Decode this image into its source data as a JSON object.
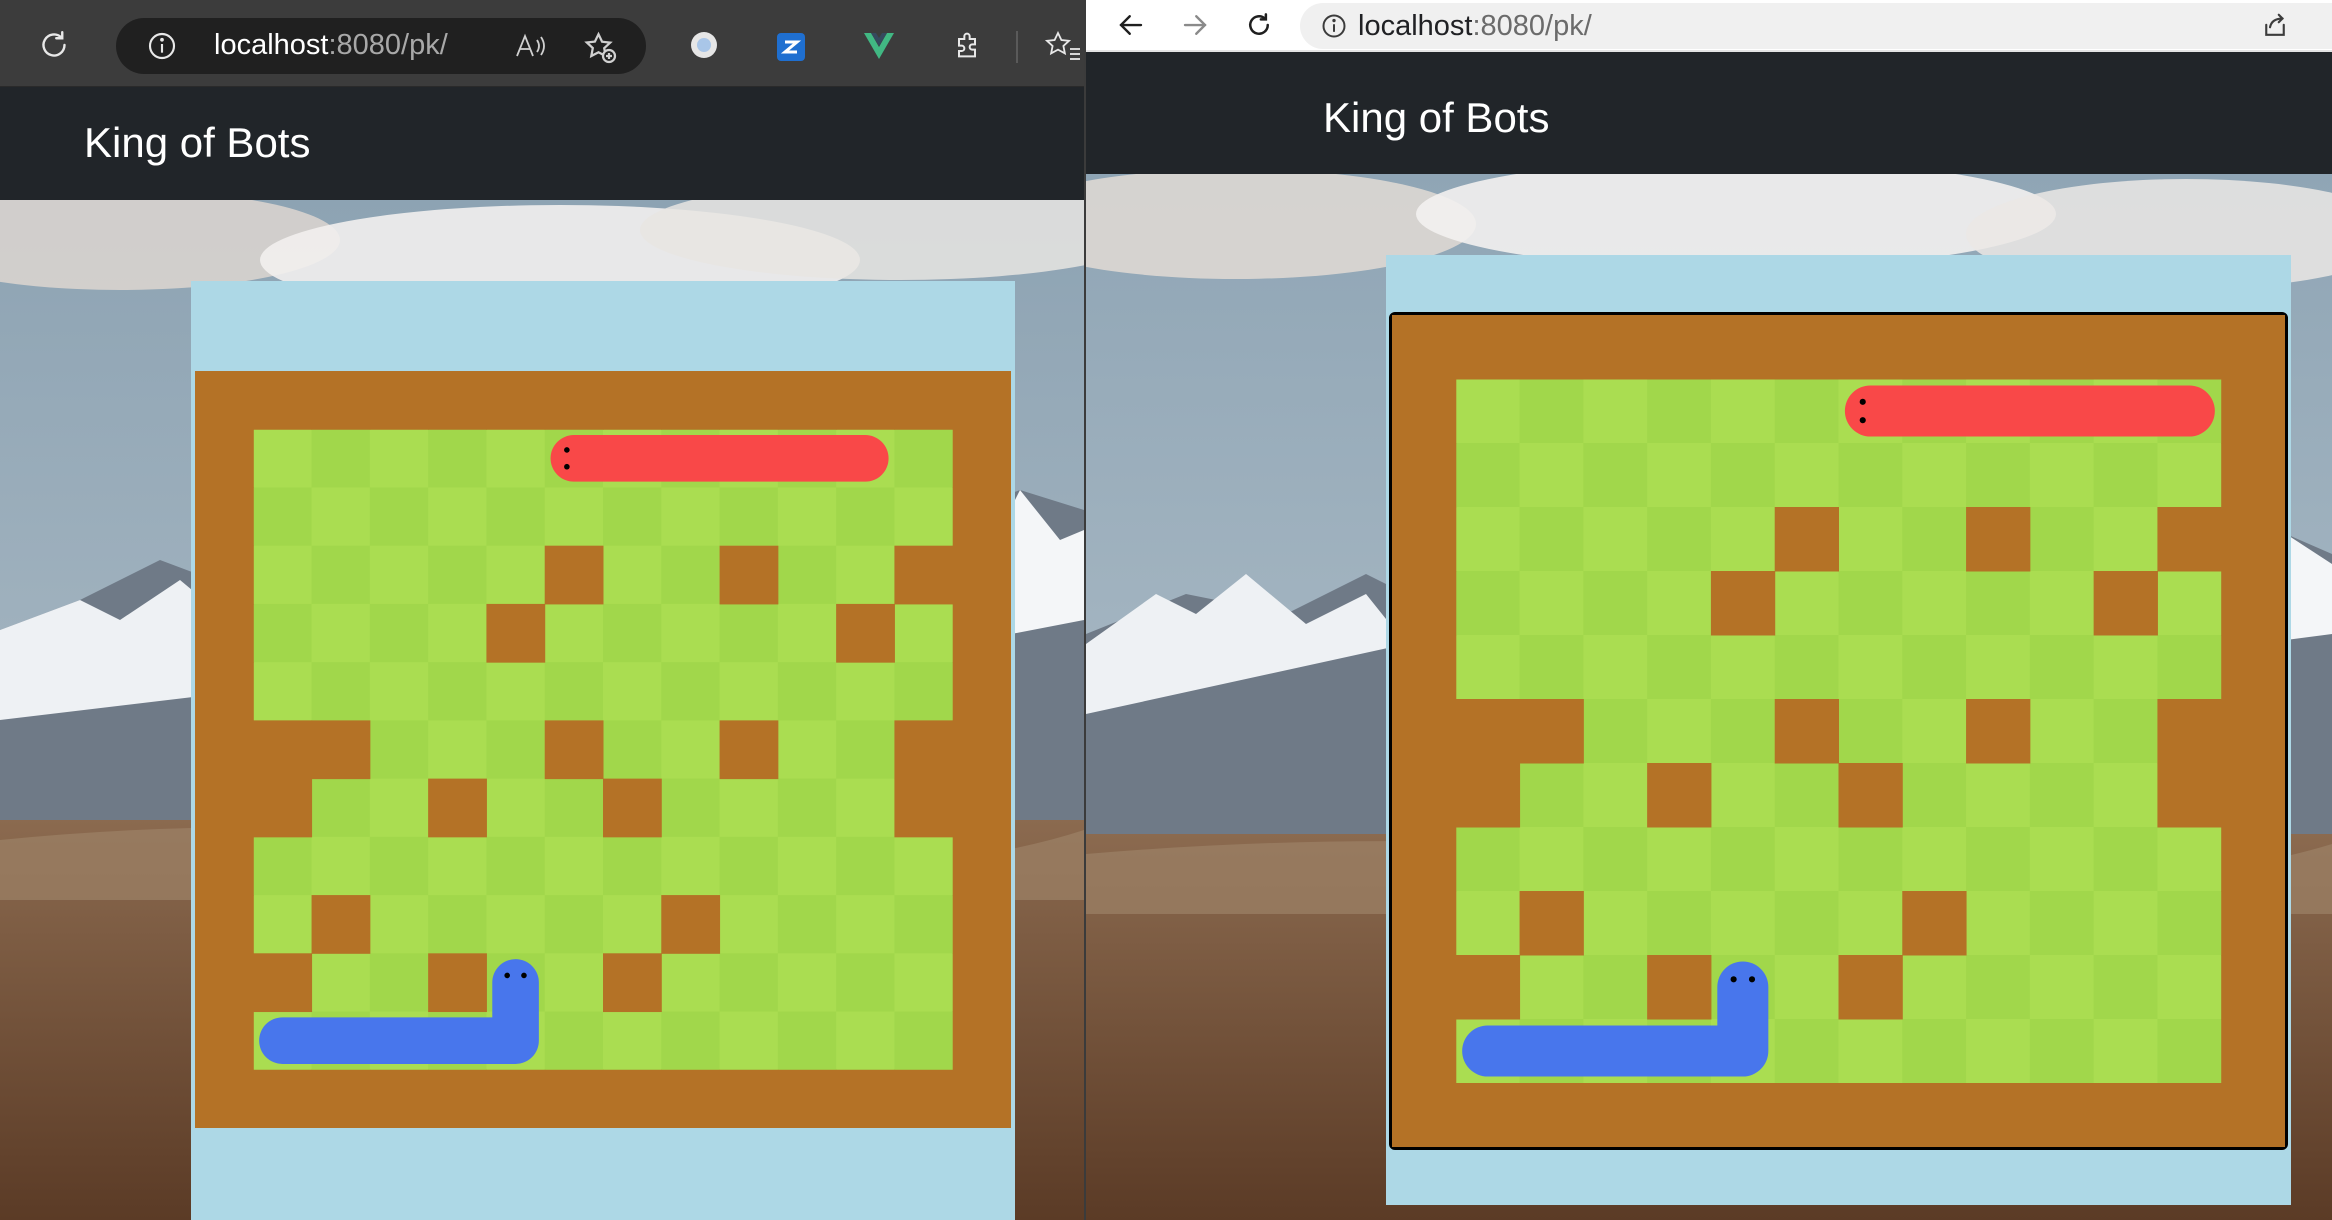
{
  "browser": {
    "url_host": "localhost",
    "url_rest": ":8080/pk/"
  },
  "navbar": {
    "brand": "King of Bots"
  },
  "colors": {
    "navbar": "#212529",
    "game_area": "#add8e6",
    "wall": "#b47226",
    "grass_light": "#aadd51",
    "grass_dark": "#a1d74b",
    "snake_red": "#f94848",
    "snake_blue": "#4876ec"
  },
  "icons": {
    "left_toolbar": [
      "refresh-icon",
      "info-icon",
      "read-aloud-icon",
      "add-favorite-icon",
      "extension-circle-icon",
      "zotero-extension-icon",
      "vue-devtools-icon",
      "extensions-icon",
      "favorites-icon"
    ],
    "right_toolbar": [
      "back-icon",
      "forward-icon",
      "refresh-icon",
      "info-icon",
      "share-icon"
    ]
  },
  "game": {
    "left": {
      "rows": 13,
      "cols": 14,
      "walls": [
        [
          0,
          0
        ],
        [
          0,
          1
        ],
        [
          0,
          2
        ],
        [
          0,
          3
        ],
        [
          0,
          4
        ],
        [
          0,
          5
        ],
        [
          0,
          6
        ],
        [
          0,
          7
        ],
        [
          0,
          8
        ],
        [
          0,
          9
        ],
        [
          0,
          10
        ],
        [
          0,
          11
        ],
        [
          0,
          12
        ],
        [
          0,
          13
        ],
        [
          12,
          0
        ],
        [
          12,
          1
        ],
        [
          12,
          2
        ],
        [
          12,
          3
        ],
        [
          12,
          4
        ],
        [
          12,
          5
        ],
        [
          12,
          6
        ],
        [
          12,
          7
        ],
        [
          12,
          8
        ],
        [
          12,
          9
        ],
        [
          12,
          10
        ],
        [
          12,
          11
        ],
        [
          12,
          12
        ],
        [
          12,
          13
        ],
        [
          1,
          0
        ],
        [
          2,
          0
        ],
        [
          3,
          0
        ],
        [
          4,
          0
        ],
        [
          5,
          0
        ],
        [
          6,
          0
        ],
        [
          7,
          0
        ],
        [
          8,
          0
        ],
        [
          9,
          0
        ],
        [
          10,
          0
        ],
        [
          11,
          0
        ],
        [
          1,
          13
        ],
        [
          2,
          13
        ],
        [
          3,
          13
        ],
        [
          4,
          13
        ],
        [
          5,
          13
        ],
        [
          6,
          13
        ],
        [
          7,
          13
        ],
        [
          8,
          13
        ],
        [
          9,
          13
        ],
        [
          10,
          13
        ],
        [
          11,
          13
        ],
        [
          3,
          12
        ],
        [
          6,
          1
        ],
        [
          6,
          2
        ],
        [
          7,
          1
        ],
        [
          7,
          12
        ],
        [
          10,
          1
        ],
        [
          6,
          12
        ],
        [
          3,
          6
        ],
        [
          3,
          9
        ],
        [
          4,
          5
        ],
        [
          4,
          11
        ],
        [
          6,
          6
        ],
        [
          6,
          9
        ],
        [
          7,
          4
        ],
        [
          7,
          7
        ],
        [
          9,
          2
        ],
        [
          9,
          8
        ],
        [
          10,
          4
        ],
        [
          10,
          7
        ]
      ],
      "snake_red": [
        [
          1,
          6
        ],
        [
          1,
          7
        ],
        [
          1,
          8
        ],
        [
          1,
          9
        ],
        [
          1,
          10
        ],
        [
          1,
          11
        ]
      ],
      "snake_blue": [
        [
          10,
          5
        ],
        [
          11,
          5
        ],
        [
          11,
          4
        ],
        [
          11,
          3
        ],
        [
          11,
          2
        ],
        [
          11,
          1
        ]
      ]
    },
    "right": {
      "rows": 13,
      "cols": 14,
      "walls": [
        [
          0,
          0
        ],
        [
          0,
          1
        ],
        [
          0,
          2
        ],
        [
          0,
          3
        ],
        [
          0,
          4
        ],
        [
          0,
          5
        ],
        [
          0,
          6
        ],
        [
          0,
          7
        ],
        [
          0,
          8
        ],
        [
          0,
          9
        ],
        [
          0,
          10
        ],
        [
          0,
          11
        ],
        [
          0,
          12
        ],
        [
          0,
          13
        ],
        [
          12,
          0
        ],
        [
          12,
          1
        ],
        [
          12,
          2
        ],
        [
          12,
          3
        ],
        [
          12,
          4
        ],
        [
          12,
          5
        ],
        [
          12,
          6
        ],
        [
          12,
          7
        ],
        [
          12,
          8
        ],
        [
          12,
          9
        ],
        [
          12,
          10
        ],
        [
          12,
          11
        ],
        [
          12,
          12
        ],
        [
          12,
          13
        ],
        [
          1,
          0
        ],
        [
          2,
          0
        ],
        [
          3,
          0
        ],
        [
          4,
          0
        ],
        [
          5,
          0
        ],
        [
          6,
          0
        ],
        [
          7,
          0
        ],
        [
          8,
          0
        ],
        [
          9,
          0
        ],
        [
          10,
          0
        ],
        [
          11,
          0
        ],
        [
          1,
          13
        ],
        [
          2,
          13
        ],
        [
          3,
          13
        ],
        [
          4,
          13
        ],
        [
          5,
          13
        ],
        [
          6,
          13
        ],
        [
          7,
          13
        ],
        [
          8,
          13
        ],
        [
          9,
          13
        ],
        [
          10,
          13
        ],
        [
          11,
          13
        ],
        [
          3,
          12
        ],
        [
          6,
          1
        ],
        [
          6,
          2
        ],
        [
          7,
          1
        ],
        [
          7,
          12
        ],
        [
          10,
          1
        ],
        [
          6,
          12
        ],
        [
          3,
          6
        ],
        [
          3,
          9
        ],
        [
          4,
          5
        ],
        [
          4,
          11
        ],
        [
          6,
          6
        ],
        [
          6,
          9
        ],
        [
          7,
          4
        ],
        [
          7,
          7
        ],
        [
          9,
          2
        ],
        [
          9,
          8
        ],
        [
          10,
          4
        ],
        [
          10,
          7
        ]
      ],
      "snake_red": [
        [
          1,
          7
        ],
        [
          1,
          8
        ],
        [
          1,
          9
        ],
        [
          1,
          10
        ],
        [
          1,
          11
        ],
        [
          1,
          12
        ]
      ],
      "snake_blue": [
        [
          10,
          5
        ],
        [
          11,
          5
        ],
        [
          11,
          4
        ],
        [
          11,
          3
        ],
        [
          11,
          2
        ],
        [
          11,
          1
        ]
      ]
    }
  }
}
